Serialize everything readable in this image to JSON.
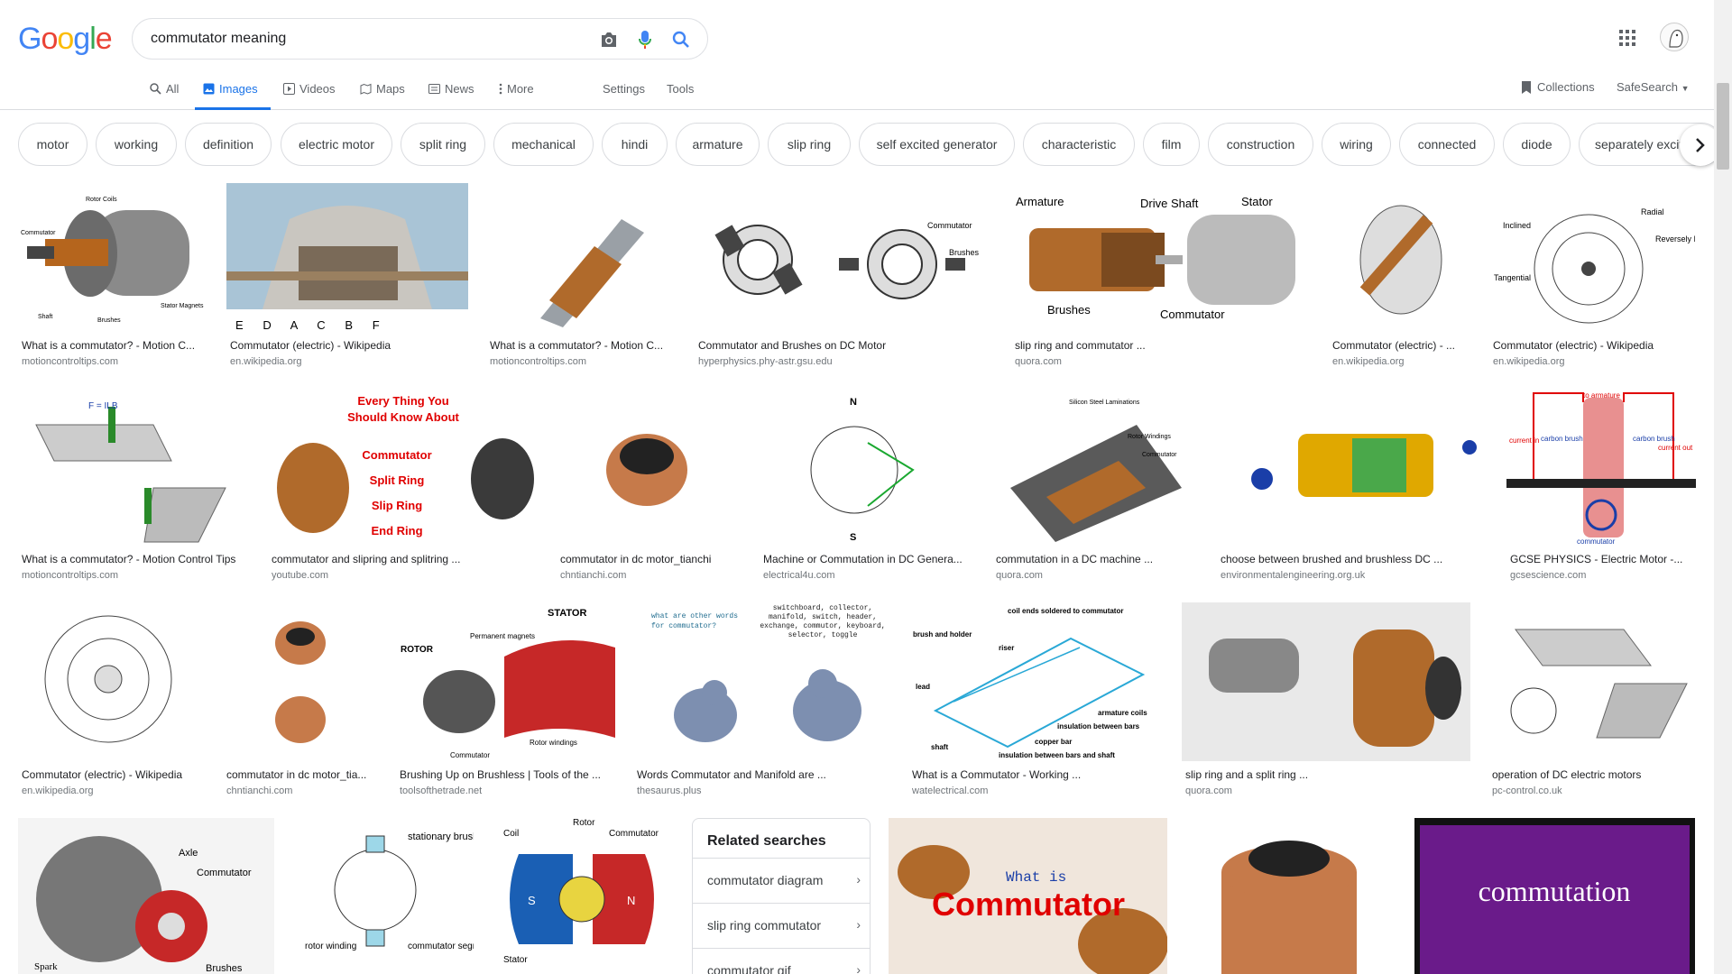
{
  "logo": {
    "text": "Google",
    "letters": [
      "G",
      "o",
      "o",
      "g",
      "l",
      "e"
    ],
    "colors": [
      "#4285F4",
      "#EA4335",
      "#FBBC05",
      "#4285F4",
      "#34A853",
      "#EA4335"
    ]
  },
  "search": {
    "value": "commutator meaning"
  },
  "nav": {
    "tabs": [
      {
        "label": "All",
        "icon": "search-icon"
      },
      {
        "label": "Images",
        "icon": "image-icon",
        "active": true
      },
      {
        "label": "Videos",
        "icon": "video-icon"
      },
      {
        "label": "Maps",
        "icon": "map-icon"
      },
      {
        "label": "News",
        "icon": "news-icon"
      },
      {
        "label": "More",
        "icon": "more-icon"
      },
      {
        "label": "Settings"
      },
      {
        "label": "Tools"
      }
    ],
    "collections": "Collections",
    "safesearch": "SafeSearch"
  },
  "chips": [
    "motor",
    "working",
    "definition",
    "electric motor",
    "split ring",
    "mechanical",
    "hindi",
    "armature",
    "slip ring",
    "self excited generator",
    "characteristic",
    "film",
    "construction",
    "wiring",
    "connected",
    "diode",
    "separately excited"
  ],
  "results": [
    {
      "title": "What is a commutator? - Motion C...",
      "site": "motioncontroltips.com"
    },
    {
      "title": "Commutator (electric) - Wikipedia",
      "site": "en.wikipedia.org"
    },
    {
      "title": "What is a commutator? - Motion C...",
      "site": "motioncontroltips.com"
    },
    {
      "title": "Commutator and Brushes on DC Motor",
      "site": "hyperphysics.phy-astr.gsu.edu"
    },
    {
      "title": "slip ring and commutator ...",
      "site": "quora.com"
    },
    {
      "title": "Commutator (electric) - ...",
      "site": "en.wikipedia.org"
    },
    {
      "title": "Commutator (electric) - Wikipedia",
      "site": "en.wikipedia.org"
    },
    {
      "title": "What is a commutator? - Motion Control Tips",
      "site": "motioncontroltips.com"
    },
    {
      "title": "commutator and slipring and splitring ...",
      "site": "youtube.com"
    },
    {
      "title": "commutator in dc motor_tianchi",
      "site": "chntianchi.com"
    },
    {
      "title": "Machine or Commutation in DC Genera...",
      "site": "electrical4u.com"
    },
    {
      "title": "commutation in a DC machine ...",
      "site": "quora.com"
    },
    {
      "title": "choose between brushed and brushless DC ...",
      "site": "environmentalengineering.org.uk"
    },
    {
      "title": "GCSE PHYSICS - Electric Motor -...",
      "site": "gcsescience.com"
    },
    {
      "title": "Commutator (electric) - Wikipedia",
      "site": "en.wikipedia.org"
    },
    {
      "title": "commutator in dc motor_tia...",
      "site": "chntianchi.com"
    },
    {
      "title": "Brushing Up on Brushless | Tools of the ...",
      "site": "toolsofthetrade.net"
    },
    {
      "title": "Words Commutator and Manifold are ...",
      "site": "thesaurus.plus"
    },
    {
      "title": "What is a Commutator - Working ...",
      "site": "watelectrical.com"
    },
    {
      "title": "slip ring and a split ring ...",
      "site": "quora.com"
    },
    {
      "title": "operation of DC electric motors",
      "site": "pc-control.co.uk"
    }
  ],
  "image_text": {
    "r1_rotor": "Rotor Coils",
    "r1_comm": "Commutator",
    "r1_shaft": "Shaft",
    "r1_brushes": "Brushes",
    "r1_stator": "Stator Magnets",
    "r2_letters": "E      D      A      C      B      F",
    "r4_comm": "Commutator",
    "r4_brushes": "Brushes",
    "r5_arm": "Armature",
    "r5_drive": "Drive Shaft",
    "r5_stator": "Stator",
    "r5_brushes": "Brushes",
    "r5_comm": "Commutator",
    "r7_radial": "Radial",
    "r7_rev": "Reversely Inclined",
    "r7_inclined": "Inclined",
    "r7_tang": "Tangential",
    "r8_force": "F = ILB",
    "r9_l1": "Every Thing You",
    "r9_l2": "Should Know About",
    "r9_l3": "Commutator",
    "r9_l4": "Split Ring",
    "r9_l5": "Slip Ring",
    "r9_l6": "End Ring",
    "r11_n": "N",
    "r11_s": "S",
    "r12_sil": "Silicon Steel Laminations",
    "r12_rw": "Rotor Windings",
    "r12_comm": "Commutator",
    "r14_arm": "to armature",
    "r14_carbon1": "carbon brush",
    "r14_carbon2": "carbon brush",
    "r14_comm": "commutator",
    "r14_cin": "current in",
    "r14_cout": "current out",
    "r17_stator": "STATOR",
    "r17_rotor": "ROTOR",
    "r17_perm": "Permanent magnets",
    "r17_rw": "Rotor windings",
    "r17_comm": "Commutator",
    "r18_q": "what are other words for commutator?",
    "r18_a": "switchboard, collector, manifold, switch, header, exchange, commutor, keyboard, selector, toggle",
    "r19_coil": "coil ends soldered to commutator",
    "r19_brush": "brush and holder",
    "r19_riser": "riser",
    "r19_lead": "lead",
    "r19_shaft": "shaft",
    "r19_arm": "armature coils",
    "r19_ins": "insulation between bars",
    "r19_cb": "copper bar",
    "r19_ins2": "insulation between bars and shaft",
    "b1_axle": "Axle",
    "b1_comm": "Commutator",
    "b1_spark": "Spark",
    "b1_brushes": "Brushes",
    "b2_stat": "stationary brush",
    "b2_rotor": "rotor winding",
    "b2_seg": "commutator segment",
    "b3_rotor": "Rotor",
    "b3_coil": "Coil",
    "b3_comm": "Commutator",
    "b3_stator": "Stator",
    "b3_s": "S",
    "b3_n": "N",
    "b4_what": "What is",
    "b4_comm": "Commutator",
    "b6_text": "commutation"
  },
  "related": {
    "title": "Related searches",
    "items": [
      "commutator diagram",
      "slip ring commutator",
      "commutator gif"
    ]
  }
}
